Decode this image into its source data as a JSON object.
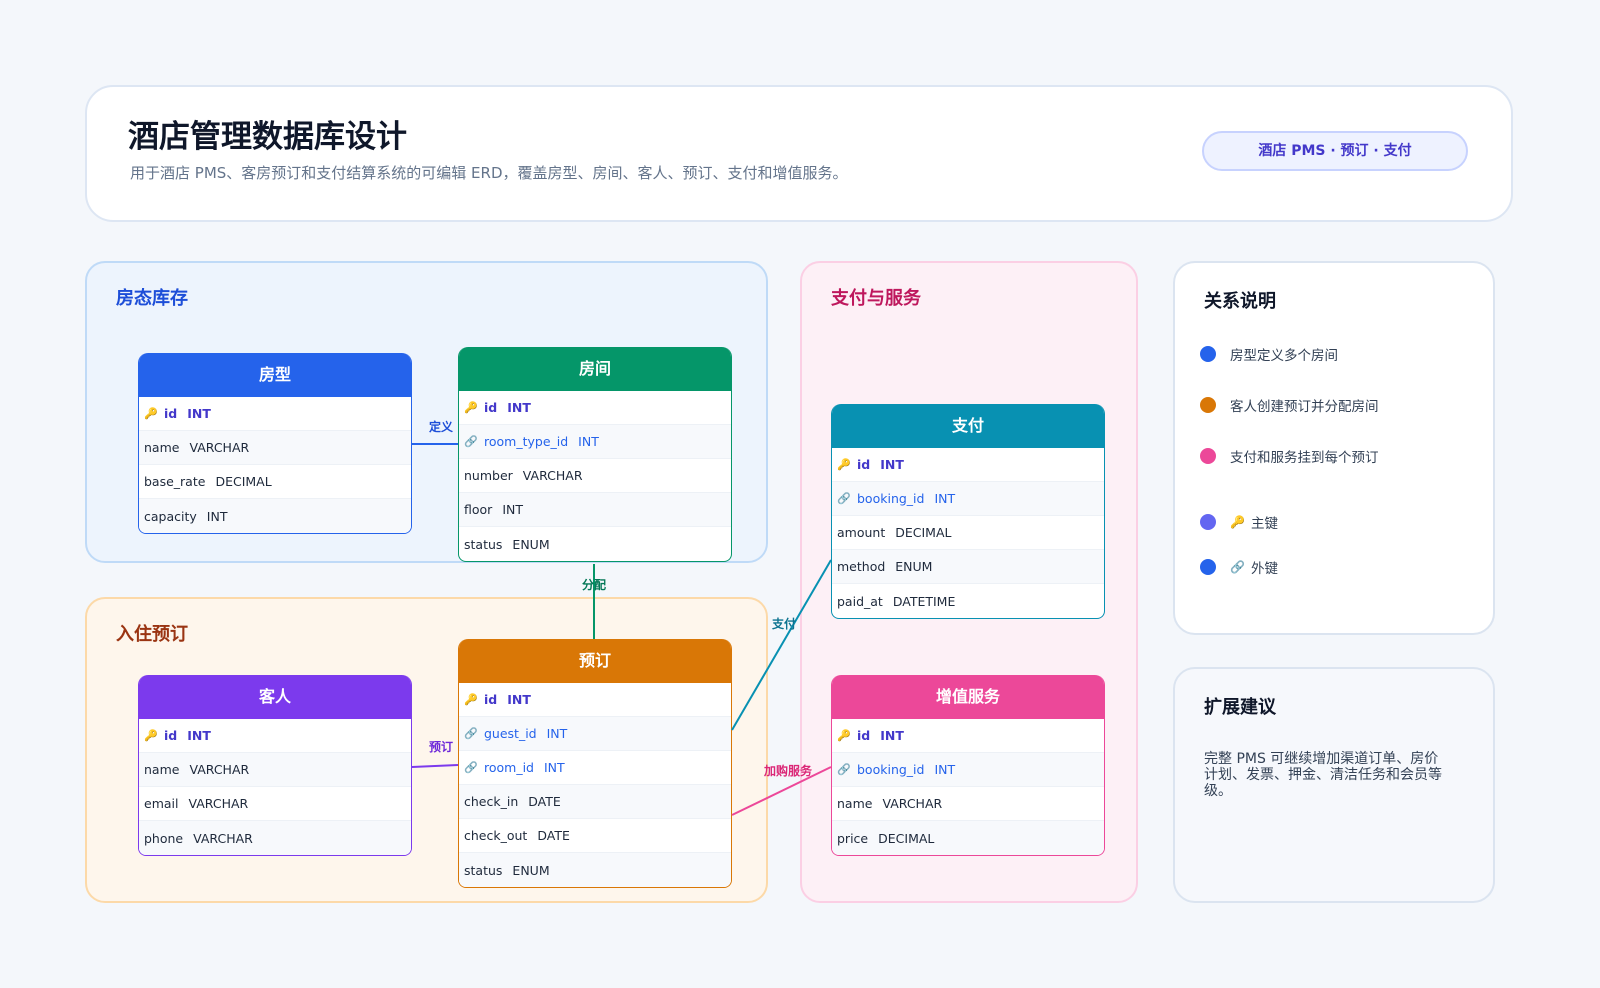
{
  "header": {
    "title": "酒店管理数据库设计",
    "subtitle": "用于酒店 PMS、客房预订和支付结算系统的可编辑 ERD，覆盖房型、房间、客人、预订、支付和增值服务。",
    "badge": "酒店 PMS · 预订 · 支付"
  },
  "groups": {
    "inventory": "房态库存",
    "booking": "入住预订",
    "payment": "支付与服务"
  },
  "entities": {
    "room_type": {
      "title": "房型",
      "fields": [
        {
          "name": "id",
          "type": "INT"
        },
        {
          "name": "name",
          "type": "VARCHAR"
        },
        {
          "name": "base_rate",
          "type": "DECIMAL"
        },
        {
          "name": "capacity",
          "type": "INT"
        }
      ]
    },
    "room": {
      "title": "房间",
      "fields": [
        {
          "name": "id",
          "type": "INT"
        },
        {
          "name": "room_type_id",
          "type": "INT"
        },
        {
          "name": "number",
          "type": "VARCHAR"
        },
        {
          "name": "floor",
          "type": "INT"
        },
        {
          "name": "status",
          "type": "ENUM"
        }
      ]
    },
    "guest": {
      "title": "客人",
      "fields": [
        {
          "name": "id",
          "type": "INT"
        },
        {
          "name": "name",
          "type": "VARCHAR"
        },
        {
          "name": "email",
          "type": "VARCHAR"
        },
        {
          "name": "phone",
          "type": "VARCHAR"
        }
      ]
    },
    "booking": {
      "title": "预订",
      "fields": [
        {
          "name": "id",
          "type": "INT"
        },
        {
          "name": "guest_id",
          "type": "INT"
        },
        {
          "name": "room_id",
          "type": "INT"
        },
        {
          "name": "check_in",
          "type": "DATE"
        },
        {
          "name": "check_out",
          "type": "DATE"
        },
        {
          "name": "status",
          "type": "ENUM"
        }
      ]
    },
    "payment": {
      "title": "支付",
      "fields": [
        {
          "name": "id",
          "type": "INT"
        },
        {
          "name": "booking_id",
          "type": "INT"
        },
        {
          "name": "amount",
          "type": "DECIMAL"
        },
        {
          "name": "method",
          "type": "ENUM"
        },
        {
          "name": "paid_at",
          "type": "DATETIME"
        }
      ]
    },
    "service": {
      "title": "增值服务",
      "fields": [
        {
          "name": "id",
          "type": "INT"
        },
        {
          "name": "booking_id",
          "type": "INT"
        },
        {
          "name": "name",
          "type": "VARCHAR"
        },
        {
          "name": "price",
          "type": "DECIMAL"
        }
      ]
    }
  },
  "relations": {
    "define": "定义",
    "assign": "分配",
    "reserve": "预订",
    "pay": "支付",
    "addon": "加购服务"
  },
  "legend": {
    "title": "关系说明",
    "items": [
      {
        "text": "房型定义多个房间",
        "color": "#2563eb"
      },
      {
        "text": "客人创建预订并分配房间",
        "color": "#d97706"
      },
      {
        "text": "支付和服务挂到每个预订",
        "color": "#ec4899"
      },
      {
        "text": "主键",
        "color": "#6366f1",
        "icon": "key-icon"
      },
      {
        "text": "外键",
        "color": "#2563eb",
        "icon": "link-icon"
      }
    ]
  },
  "extension": {
    "title": "扩展建议",
    "text": "完整 PMS 可继续增加渠道订单、房价计划、发票、押金、清洁任务和会员等级。"
  },
  "colors": {
    "room_type": "#2563eb",
    "room": "#059669",
    "guest": "#7c3aed",
    "booking": "#d97706",
    "payment": "#0891b2",
    "service": "#ec4899"
  }
}
